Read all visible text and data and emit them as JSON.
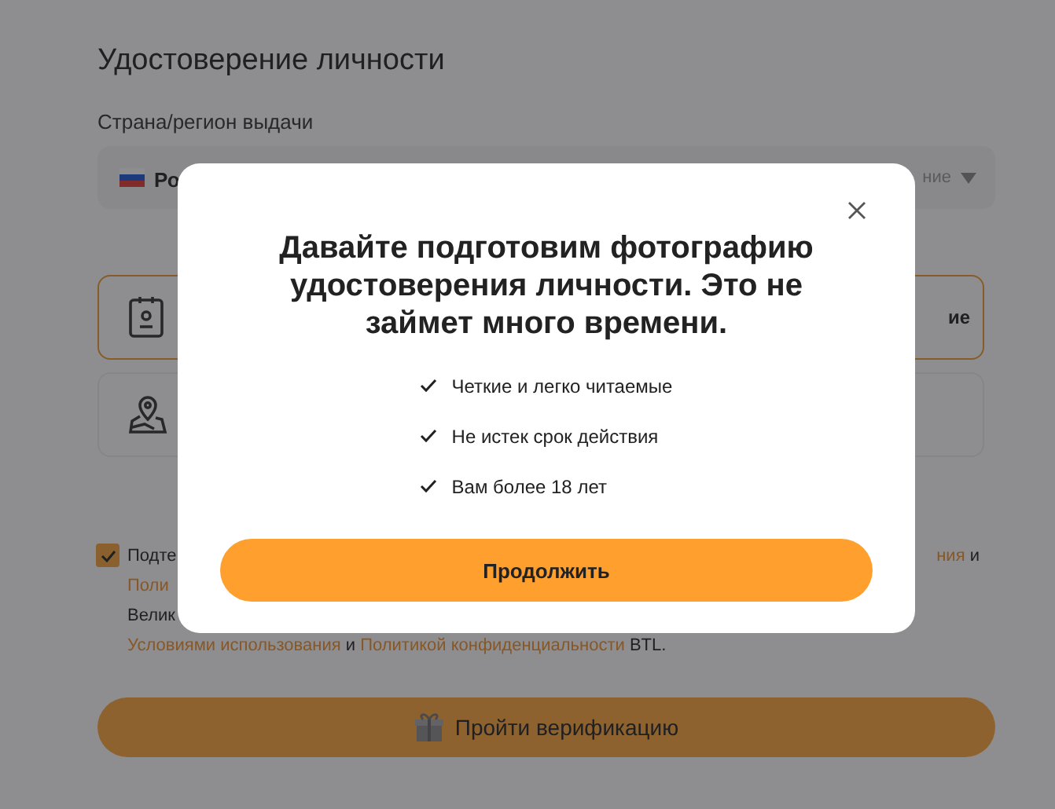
{
  "page": {
    "title": "Удостоверение личности",
    "country_label": "Страна/регион выдачи",
    "country_select": {
      "value": "Ро",
      "hint": "ние"
    },
    "options": [
      {
        "kind": "document",
        "text": "ие",
        "selected": true
      },
      {
        "kind": "address",
        "selected": false
      }
    ],
    "consent": {
      "checked": true,
      "lines": [
        {
          "start": [
            {
              "text": "Подте",
              "link": false
            }
          ],
          "end": [
            {
              "text": "ния",
              "link": true
            },
            {
              "text": " и",
              "link": false
            }
          ]
        },
        {
          "start": [
            {
              "text": "Поли",
              "link": true
            }
          ]
        },
        {
          "start": [
            {
              "text": "Велик",
              "link": false
            }
          ]
        },
        {
          "start": [
            {
              "text": "Условиями использования",
              "link": true
            },
            {
              "text": " и ",
              "link": false
            },
            {
              "text": "Политикой конфиденциальности",
              "link": true
            },
            {
              "text": " BTL.",
              "link": false
            }
          ]
        }
      ]
    },
    "submit_button": "Пройти верификацию"
  },
  "modal": {
    "title": "Давайте подготовим фотографию удостоверения личности. Это не займет много времени.",
    "requirements": [
      "Четкие и легко читаемые",
      "Не истек срок действия",
      "Вам более 18 лет"
    ],
    "button": "Продолжить"
  }
}
